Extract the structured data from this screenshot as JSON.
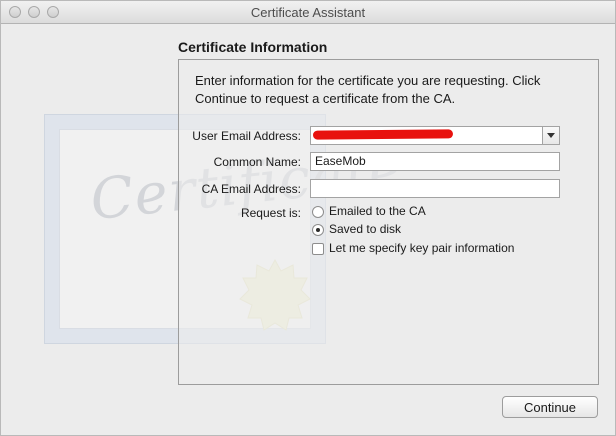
{
  "window": {
    "title": "Certificate Assistant"
  },
  "art": {
    "word": "Certificate"
  },
  "section": {
    "heading": "Certificate Information"
  },
  "intro": "Enter information for the certificate you are requesting. Click Continue to request a certificate from the CA.",
  "form": {
    "user_email": {
      "label": "User Email Address:",
      "value": ""
    },
    "common_name": {
      "label": "Common Name:",
      "value": "EaseMob"
    },
    "ca_email": {
      "label": "CA Email Address:",
      "value": ""
    },
    "request": {
      "label": "Request is:",
      "options": [
        {
          "label": "Emailed to the CA",
          "selected": false
        },
        {
          "label": "Saved to disk",
          "selected": true
        }
      ]
    },
    "key_pair": {
      "label": "Let me specify key pair information",
      "checked": false
    }
  },
  "buttons": {
    "continue": "Continue"
  },
  "colors": {
    "redaction": "#e8120e",
    "window_bg": "#ececec"
  }
}
